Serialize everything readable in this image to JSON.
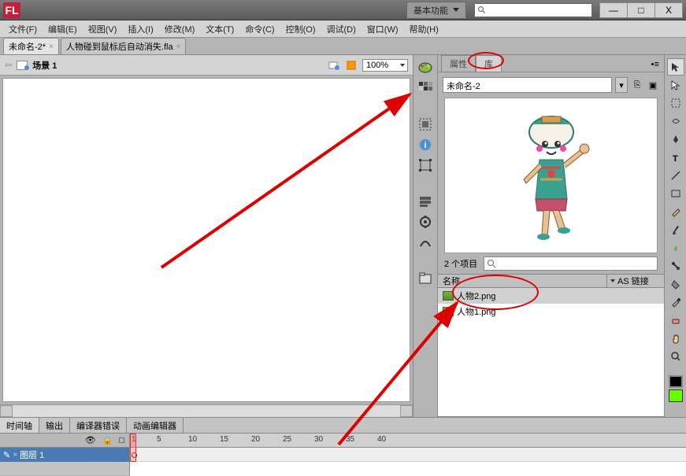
{
  "app_logo": "FL",
  "workspace": "基本功能",
  "window_buttons": {
    "min": "—",
    "max": "□",
    "close": "X"
  },
  "menus": [
    "文件(F)",
    "编辑(E)",
    "视图(V)",
    "插入(I)",
    "修改(M)",
    "文本(T)",
    "命令(C)",
    "控制(O)",
    "调试(D)",
    "窗口(W)",
    "帮助(H)"
  ],
  "doc_tabs": [
    {
      "label": "未命名-2*",
      "active": true
    },
    {
      "label": "人物碰到鼠标后自动消失.fla",
      "active": false
    }
  ],
  "scene_label": "场景 1",
  "zoom": "100%",
  "panel_tabs": [
    {
      "label": "属性",
      "active": false
    },
    {
      "label": "库",
      "active": true
    }
  ],
  "doc_select": "未命名-2",
  "item_count": "2 个项目",
  "lib_headers": {
    "name": "名称",
    "link": "AS 链接"
  },
  "lib_items": [
    {
      "label": "人物2.png",
      "selected": true
    },
    {
      "label": "人物1.png",
      "selected": false
    }
  ],
  "bottom_tabs": [
    "时间轴",
    "输出",
    "编译器错误",
    "动画编辑器"
  ],
  "layer_name": "图层 1",
  "frame_numbers": [
    1,
    5,
    10,
    15,
    20,
    25,
    30,
    35,
    40
  ],
  "colors": {
    "green": "#66ff00",
    "black": "#000"
  }
}
